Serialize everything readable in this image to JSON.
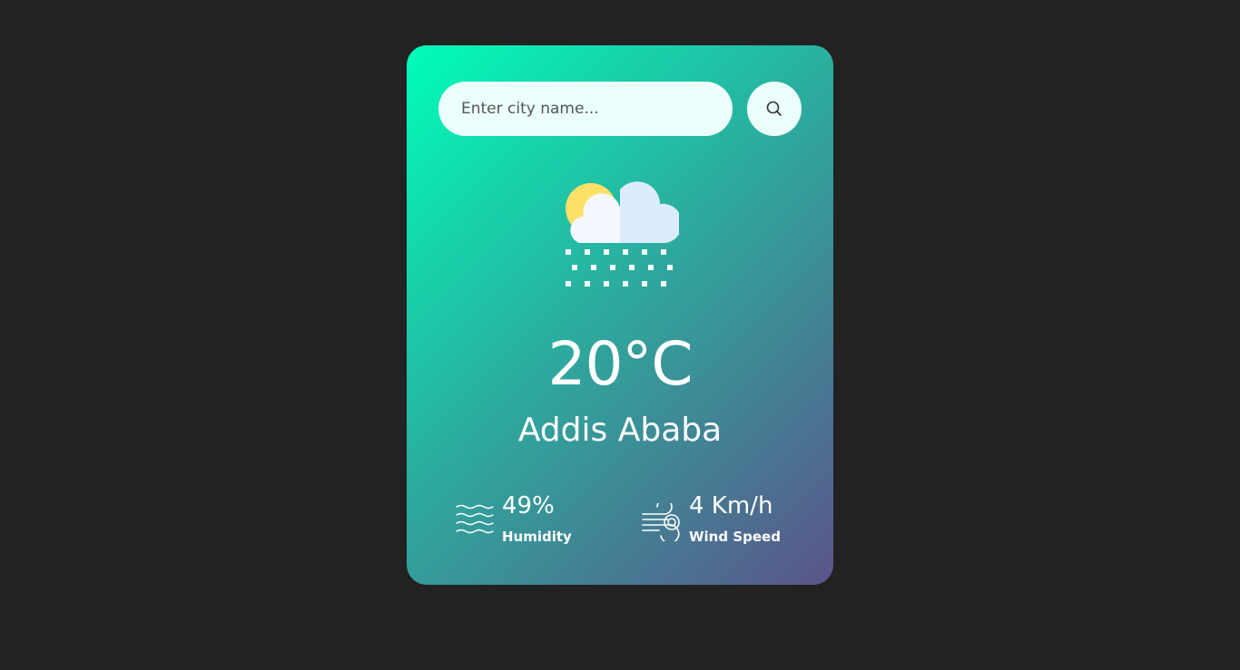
{
  "search": {
    "placeholder": "Enter city name...",
    "value": "",
    "button_icon": "search-icon"
  },
  "weather": {
    "icon": "snow-cloud-sun-icon",
    "temperature": "20°C",
    "city": "Addis Ababa"
  },
  "details": {
    "humidity": {
      "icon": "humidity-waves-icon",
      "value": "49%",
      "label": "Humidity"
    },
    "wind": {
      "icon": "wind-icon",
      "value": "4 Km/h",
      "label": "Wind Speed"
    }
  },
  "colors": {
    "page_background": "#222222",
    "card_gradient_start": "#00feba",
    "card_gradient_end": "#5b548a",
    "input_background": "#ebfffc",
    "text": "#ffffff"
  }
}
